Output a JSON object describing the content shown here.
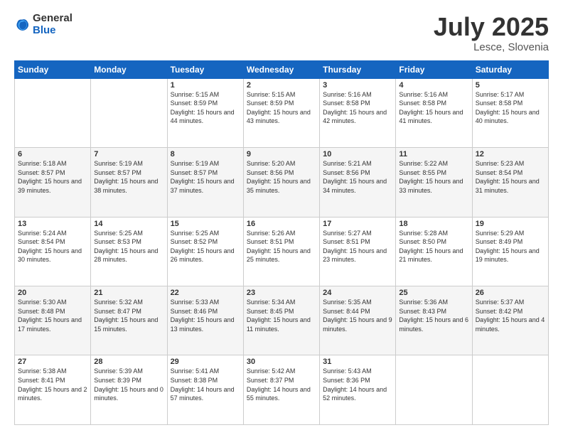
{
  "logo": {
    "general": "General",
    "blue": "Blue"
  },
  "title": "July 2025",
  "location": "Lesce, Slovenia",
  "days_header": [
    "Sunday",
    "Monday",
    "Tuesday",
    "Wednesday",
    "Thursday",
    "Friday",
    "Saturday"
  ],
  "weeks": [
    [
      {
        "day": "",
        "sunrise": "",
        "sunset": "",
        "daylight": ""
      },
      {
        "day": "",
        "sunrise": "",
        "sunset": "",
        "daylight": ""
      },
      {
        "day": "1",
        "sunrise": "Sunrise: 5:15 AM",
        "sunset": "Sunset: 8:59 PM",
        "daylight": "Daylight: 15 hours and 44 minutes."
      },
      {
        "day": "2",
        "sunrise": "Sunrise: 5:15 AM",
        "sunset": "Sunset: 8:59 PM",
        "daylight": "Daylight: 15 hours and 43 minutes."
      },
      {
        "day": "3",
        "sunrise": "Sunrise: 5:16 AM",
        "sunset": "Sunset: 8:58 PM",
        "daylight": "Daylight: 15 hours and 42 minutes."
      },
      {
        "day": "4",
        "sunrise": "Sunrise: 5:16 AM",
        "sunset": "Sunset: 8:58 PM",
        "daylight": "Daylight: 15 hours and 41 minutes."
      },
      {
        "day": "5",
        "sunrise": "Sunrise: 5:17 AM",
        "sunset": "Sunset: 8:58 PM",
        "daylight": "Daylight: 15 hours and 40 minutes."
      }
    ],
    [
      {
        "day": "6",
        "sunrise": "Sunrise: 5:18 AM",
        "sunset": "Sunset: 8:57 PM",
        "daylight": "Daylight: 15 hours and 39 minutes."
      },
      {
        "day": "7",
        "sunrise": "Sunrise: 5:19 AM",
        "sunset": "Sunset: 8:57 PM",
        "daylight": "Daylight: 15 hours and 38 minutes."
      },
      {
        "day": "8",
        "sunrise": "Sunrise: 5:19 AM",
        "sunset": "Sunset: 8:57 PM",
        "daylight": "Daylight: 15 hours and 37 minutes."
      },
      {
        "day": "9",
        "sunrise": "Sunrise: 5:20 AM",
        "sunset": "Sunset: 8:56 PM",
        "daylight": "Daylight: 15 hours and 35 minutes."
      },
      {
        "day": "10",
        "sunrise": "Sunrise: 5:21 AM",
        "sunset": "Sunset: 8:56 PM",
        "daylight": "Daylight: 15 hours and 34 minutes."
      },
      {
        "day": "11",
        "sunrise": "Sunrise: 5:22 AM",
        "sunset": "Sunset: 8:55 PM",
        "daylight": "Daylight: 15 hours and 33 minutes."
      },
      {
        "day": "12",
        "sunrise": "Sunrise: 5:23 AM",
        "sunset": "Sunset: 8:54 PM",
        "daylight": "Daylight: 15 hours and 31 minutes."
      }
    ],
    [
      {
        "day": "13",
        "sunrise": "Sunrise: 5:24 AM",
        "sunset": "Sunset: 8:54 PM",
        "daylight": "Daylight: 15 hours and 30 minutes."
      },
      {
        "day": "14",
        "sunrise": "Sunrise: 5:25 AM",
        "sunset": "Sunset: 8:53 PM",
        "daylight": "Daylight: 15 hours and 28 minutes."
      },
      {
        "day": "15",
        "sunrise": "Sunrise: 5:25 AM",
        "sunset": "Sunset: 8:52 PM",
        "daylight": "Daylight: 15 hours and 26 minutes."
      },
      {
        "day": "16",
        "sunrise": "Sunrise: 5:26 AM",
        "sunset": "Sunset: 8:51 PM",
        "daylight": "Daylight: 15 hours and 25 minutes."
      },
      {
        "day": "17",
        "sunrise": "Sunrise: 5:27 AM",
        "sunset": "Sunset: 8:51 PM",
        "daylight": "Daylight: 15 hours and 23 minutes."
      },
      {
        "day": "18",
        "sunrise": "Sunrise: 5:28 AM",
        "sunset": "Sunset: 8:50 PM",
        "daylight": "Daylight: 15 hours and 21 minutes."
      },
      {
        "day": "19",
        "sunrise": "Sunrise: 5:29 AM",
        "sunset": "Sunset: 8:49 PM",
        "daylight": "Daylight: 15 hours and 19 minutes."
      }
    ],
    [
      {
        "day": "20",
        "sunrise": "Sunrise: 5:30 AM",
        "sunset": "Sunset: 8:48 PM",
        "daylight": "Daylight: 15 hours and 17 minutes."
      },
      {
        "day": "21",
        "sunrise": "Sunrise: 5:32 AM",
        "sunset": "Sunset: 8:47 PM",
        "daylight": "Daylight: 15 hours and 15 minutes."
      },
      {
        "day": "22",
        "sunrise": "Sunrise: 5:33 AM",
        "sunset": "Sunset: 8:46 PM",
        "daylight": "Daylight: 15 hours and 13 minutes."
      },
      {
        "day": "23",
        "sunrise": "Sunrise: 5:34 AM",
        "sunset": "Sunset: 8:45 PM",
        "daylight": "Daylight: 15 hours and 11 minutes."
      },
      {
        "day": "24",
        "sunrise": "Sunrise: 5:35 AM",
        "sunset": "Sunset: 8:44 PM",
        "daylight": "Daylight: 15 hours and 9 minutes."
      },
      {
        "day": "25",
        "sunrise": "Sunrise: 5:36 AM",
        "sunset": "Sunset: 8:43 PM",
        "daylight": "Daylight: 15 hours and 6 minutes."
      },
      {
        "day": "26",
        "sunrise": "Sunrise: 5:37 AM",
        "sunset": "Sunset: 8:42 PM",
        "daylight": "Daylight: 15 hours and 4 minutes."
      }
    ],
    [
      {
        "day": "27",
        "sunrise": "Sunrise: 5:38 AM",
        "sunset": "Sunset: 8:41 PM",
        "daylight": "Daylight: 15 hours and 2 minutes."
      },
      {
        "day": "28",
        "sunrise": "Sunrise: 5:39 AM",
        "sunset": "Sunset: 8:39 PM",
        "daylight": "Daylight: 15 hours and 0 minutes."
      },
      {
        "day": "29",
        "sunrise": "Sunrise: 5:41 AM",
        "sunset": "Sunset: 8:38 PM",
        "daylight": "Daylight: 14 hours and 57 minutes."
      },
      {
        "day": "30",
        "sunrise": "Sunrise: 5:42 AM",
        "sunset": "Sunset: 8:37 PM",
        "daylight": "Daylight: 14 hours and 55 minutes."
      },
      {
        "day": "31",
        "sunrise": "Sunrise: 5:43 AM",
        "sunset": "Sunset: 8:36 PM",
        "daylight": "Daylight: 14 hours and 52 minutes."
      },
      {
        "day": "",
        "sunrise": "",
        "sunset": "",
        "daylight": ""
      },
      {
        "day": "",
        "sunrise": "",
        "sunset": "",
        "daylight": ""
      }
    ]
  ]
}
